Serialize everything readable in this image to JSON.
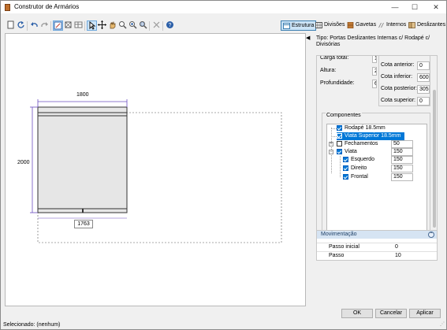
{
  "window": {
    "title": "Construtor de Armários",
    "minimize": "—",
    "maximize": "☐",
    "close": "✕"
  },
  "toolbar": {
    "tabs": [
      {
        "label": "Estrutura",
        "icon": "structure-icon",
        "active": true
      },
      {
        "label": "Divisões",
        "icon": "divisions-icon"
      },
      {
        "label": "Gavetas",
        "icon": "drawers-icon"
      },
      {
        "label": "Internos",
        "icon": "internals-icon"
      },
      {
        "label": "Deslizantes",
        "icon": "sliding-icon"
      }
    ]
  },
  "drawing": {
    "width_label": "1800",
    "height_label": "2000",
    "bottom_label": "1763"
  },
  "panel": {
    "type_text": "Tipo: Portas Deslizantes Internas c/ Rodapé c/ Divisórias",
    "left_props": [
      {
        "label": "Carga total:",
        "value": "1"
      },
      {
        "label": "Altura:",
        "value": "2"
      },
      {
        "label": "Profundidade:",
        "value": "6"
      }
    ],
    "right_props": [
      {
        "label": "Cota anterior:",
        "value": "0"
      },
      {
        "label": "Cota inferior:",
        "value": "600"
      },
      {
        "label": "Cota posterior:",
        "value": "305"
      },
      {
        "label": "Cota superior:",
        "value": "0"
      }
    ],
    "components_title": "Componentes",
    "tree": {
      "rodape": "Rodapé 18.5mm",
      "viata_superior": "Viata Superior 18.5mm",
      "fechamentos": "Fechamentos",
      "fechamentos_value": "50",
      "viata": "Viata",
      "viata_value": "150",
      "esquerdo": "Esquerdo",
      "esquerdo_value": "150",
      "direito": "Direito",
      "direito_value": "150",
      "frontal": "Frontal",
      "frontal_value": "150"
    }
  },
  "movimentacao": {
    "title": "Movimentação",
    "rows": [
      {
        "key": "Passo inicial",
        "value": "0"
      },
      {
        "key": "Passo",
        "value": "10"
      }
    ]
  },
  "buttons": {
    "ok": "OK",
    "cancel": "Cancelar",
    "apply": "Aplicar"
  },
  "status": {
    "text": "Selecionado: (nenhum)"
  },
  "colors": {
    "accent": "#0078d7",
    "dimension_lines": "#6b4fbf",
    "cabinet_fill": "#e6e6e6"
  }
}
